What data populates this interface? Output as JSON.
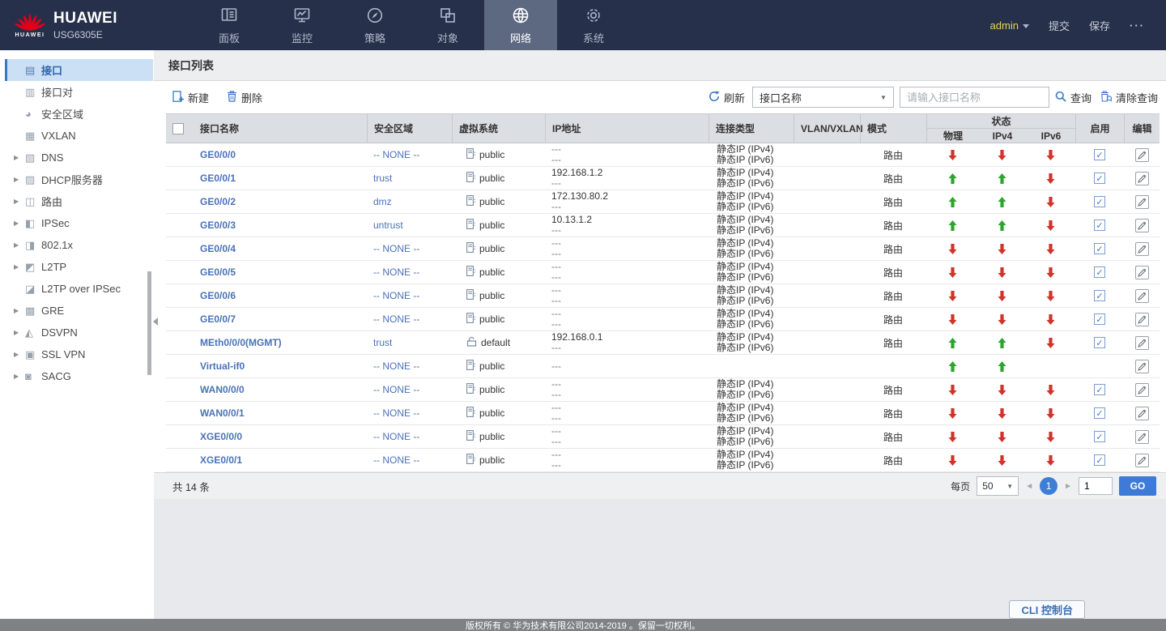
{
  "brand": {
    "logo_text": "HUAWEI",
    "product": "HUAWEI",
    "model": "USG6305E"
  },
  "topnav": {
    "items": [
      {
        "label": "面板",
        "icon": "dashboard-icon",
        "active": false
      },
      {
        "label": "监控",
        "icon": "monitor-icon",
        "active": false
      },
      {
        "label": "策略",
        "icon": "policy-icon",
        "active": false
      },
      {
        "label": "对象",
        "icon": "object-icon",
        "active": false
      },
      {
        "label": "网络",
        "icon": "network-icon",
        "active": true
      },
      {
        "label": "系统",
        "icon": "system-icon",
        "active": false
      }
    ],
    "user": "admin",
    "commit_label": "提交",
    "save_label": "保存",
    "more_label": "···"
  },
  "sidebar": {
    "items": [
      {
        "label": "接口",
        "icon": "interface-icon",
        "active": true,
        "expandable": false
      },
      {
        "label": "接口对",
        "icon": "interface-pair-icon",
        "expandable": false
      },
      {
        "label": "安全区域",
        "icon": "security-zone-icon",
        "expandable": false
      },
      {
        "label": "VXLAN",
        "icon": "vxlan-icon",
        "expandable": false
      },
      {
        "label": "DNS",
        "icon": "dns-icon",
        "expandable": true
      },
      {
        "label": "DHCP服务器",
        "icon": "dhcp-server-icon",
        "expandable": true
      },
      {
        "label": "路由",
        "icon": "route-icon",
        "expandable": true
      },
      {
        "label": "IPSec",
        "icon": "ipsec-icon",
        "expandable": true
      },
      {
        "label": "802.1x",
        "icon": "dot1x-icon",
        "expandable": true
      },
      {
        "label": "L2TP",
        "icon": "l2tp-icon",
        "expandable": true
      },
      {
        "label": "L2TP over IPSec",
        "icon": "l2tp-over-ipsec-icon",
        "expandable": false
      },
      {
        "label": "GRE",
        "icon": "gre-icon",
        "expandable": true
      },
      {
        "label": "DSVPN",
        "icon": "dsvpn-icon",
        "expandable": true
      },
      {
        "label": "SSL VPN",
        "icon": "ssl-vpn-icon",
        "expandable": true
      },
      {
        "label": "SACG",
        "icon": "sacg-icon",
        "expandable": true
      }
    ]
  },
  "page": {
    "title": "接口列表"
  },
  "toolbar": {
    "new_label": "新建",
    "delete_label": "删除",
    "refresh_label": "刷新",
    "filter_field": "接口名称",
    "search_placeholder": "请输入接口名称",
    "query_label": "查询",
    "clear_label": "清除查询"
  },
  "table": {
    "columns": {
      "name": "接口名称",
      "zone": "安全区域",
      "vsys": "虚拟系统",
      "ip": "IP地址",
      "conn": "连接类型",
      "vlan": "VLAN/VXLAN",
      "mode": "模式",
      "status": "状态",
      "phy": "物理",
      "ipv4": "IPv4",
      "ipv6": "IPv6",
      "enable": "启用",
      "edit": "编辑"
    },
    "rows": [
      {
        "name": "GE0/0/0",
        "zone": "-- NONE --",
        "vsys": "public",
        "vsys_icon": "vsys-icon",
        "ip": [
          "---",
          "---"
        ],
        "conn": [
          "静态IP (IPv4)",
          "静态IP (IPv6)"
        ],
        "vlan": "",
        "mode": "路由",
        "phy": "down",
        "ipv4": "down",
        "ipv6": "down",
        "enabled": true
      },
      {
        "name": "GE0/0/1",
        "zone": "trust",
        "vsys": "public",
        "vsys_icon": "vsys-icon",
        "ip": [
          "192.168.1.2",
          "---"
        ],
        "conn": [
          "静态IP (IPv4)",
          "静态IP (IPv6)"
        ],
        "vlan": "",
        "mode": "路由",
        "phy": "up",
        "ipv4": "up",
        "ipv6": "down",
        "enabled": true
      },
      {
        "name": "GE0/0/2",
        "zone": "dmz",
        "vsys": "public",
        "vsys_icon": "vsys-icon",
        "ip": [
          "172.130.80.2",
          "---"
        ],
        "conn": [
          "静态IP (IPv4)",
          "静态IP (IPv6)"
        ],
        "vlan": "",
        "mode": "路由",
        "phy": "up",
        "ipv4": "up",
        "ipv6": "down",
        "enabled": true
      },
      {
        "name": "GE0/0/3",
        "zone": "untrust",
        "vsys": "public",
        "vsys_icon": "vsys-icon",
        "ip": [
          "10.13.1.2",
          "---"
        ],
        "conn": [
          "静态IP (IPv4)",
          "静态IP (IPv6)"
        ],
        "vlan": "",
        "mode": "路由",
        "phy": "up",
        "ipv4": "up",
        "ipv6": "down",
        "enabled": true
      },
      {
        "name": "GE0/0/4",
        "zone": "-- NONE --",
        "vsys": "public",
        "vsys_icon": "vsys-icon",
        "ip": [
          "---",
          "---"
        ],
        "conn": [
          "静态IP (IPv4)",
          "静态IP (IPv6)"
        ],
        "vlan": "",
        "mode": "路由",
        "phy": "down",
        "ipv4": "down",
        "ipv6": "down",
        "enabled": true
      },
      {
        "name": "GE0/0/5",
        "zone": "-- NONE --",
        "vsys": "public",
        "vsys_icon": "vsys-icon",
        "ip": [
          "---",
          "---"
        ],
        "conn": [
          "静态IP (IPv4)",
          "静态IP (IPv6)"
        ],
        "vlan": "",
        "mode": "路由",
        "phy": "down",
        "ipv4": "down",
        "ipv6": "down",
        "enabled": true
      },
      {
        "name": "GE0/0/6",
        "zone": "-- NONE --",
        "vsys": "public",
        "vsys_icon": "vsys-icon",
        "ip": [
          "---",
          "---"
        ],
        "conn": [
          "静态IP (IPv4)",
          "静态IP (IPv6)"
        ],
        "vlan": "",
        "mode": "路由",
        "phy": "down",
        "ipv4": "down",
        "ipv6": "down",
        "enabled": true
      },
      {
        "name": "GE0/0/7",
        "zone": "-- NONE --",
        "vsys": "public",
        "vsys_icon": "vsys-icon",
        "ip": [
          "---",
          "---"
        ],
        "conn": [
          "静态IP (IPv4)",
          "静态IP (IPv6)"
        ],
        "vlan": "",
        "mode": "路由",
        "phy": "down",
        "ipv4": "down",
        "ipv6": "down",
        "enabled": true
      },
      {
        "name": "MEth0/0/0(MGMT)",
        "zone": "trust",
        "vsys": "default",
        "vsys_icon": "root-vsys-icon",
        "ip": [
          "192.168.0.1",
          "---"
        ],
        "conn": [
          "静态IP (IPv4)",
          "静态IP (IPv6)"
        ],
        "vlan": "",
        "mode": "路由",
        "phy": "up",
        "ipv4": "up",
        "ipv6": "down",
        "enabled": true
      },
      {
        "name": "Virtual-if0",
        "zone": "-- NONE --",
        "vsys": "public",
        "vsys_icon": "vsys-icon",
        "ip": [
          "---"
        ],
        "conn": [],
        "vlan": "",
        "mode": "",
        "phy": "up",
        "ipv4": "up",
        "ipv6": "",
        "enabled": null
      },
      {
        "name": "WAN0/0/0",
        "zone": "-- NONE --",
        "vsys": "public",
        "vsys_icon": "vsys-icon",
        "ip": [
          "---",
          "---"
        ],
        "conn": [
          "静态IP (IPv4)",
          "静态IP (IPv6)"
        ],
        "vlan": "",
        "mode": "路由",
        "phy": "down",
        "ipv4": "down",
        "ipv6": "down",
        "enabled": true
      },
      {
        "name": "WAN0/0/1",
        "zone": "-- NONE --",
        "vsys": "public",
        "vsys_icon": "vsys-icon",
        "ip": [
          "---",
          "---"
        ],
        "conn": [
          "静态IP (IPv4)",
          "静态IP (IPv6)"
        ],
        "vlan": "",
        "mode": "路由",
        "phy": "down",
        "ipv4": "down",
        "ipv6": "down",
        "enabled": true
      },
      {
        "name": "XGE0/0/0",
        "zone": "-- NONE --",
        "vsys": "public",
        "vsys_icon": "vsys-icon",
        "ip": [
          "---",
          "---"
        ],
        "conn": [
          "静态IP (IPv4)",
          "静态IP (IPv6)"
        ],
        "vlan": "",
        "mode": "路由",
        "phy": "down",
        "ipv4": "down",
        "ipv6": "down",
        "enabled": true
      },
      {
        "name": "XGE0/0/1",
        "zone": "-- NONE --",
        "vsys": "public",
        "vsys_icon": "vsys-icon",
        "ip": [
          "---",
          "---"
        ],
        "conn": [
          "静态IP (IPv4)",
          "静态IP (IPv6)"
        ],
        "vlan": "",
        "mode": "路由",
        "phy": "down",
        "ipv4": "down",
        "ipv6": "down",
        "enabled": true
      }
    ]
  },
  "pagination": {
    "total_text": "共 14 条",
    "per_page_label": "每页",
    "per_page": "50",
    "current_page": "1",
    "goto_value": "1",
    "go_label": "GO"
  },
  "cli_label": "CLI 控制台",
  "footer": {
    "copyright": "版权所有 © 华为技术有限公司2014-2019 。保留一切权利。"
  },
  "colors": {
    "accent": "#3e78c8",
    "link": "#4a72b8",
    "up_arrow": "#2ea42e",
    "down_arrow": "#ce342c",
    "topbar_bg": "#27304a",
    "active_tab_bg": "#5c6980",
    "admin_yellow": "#e8d44a",
    "header_bg": "#dbdee2"
  }
}
